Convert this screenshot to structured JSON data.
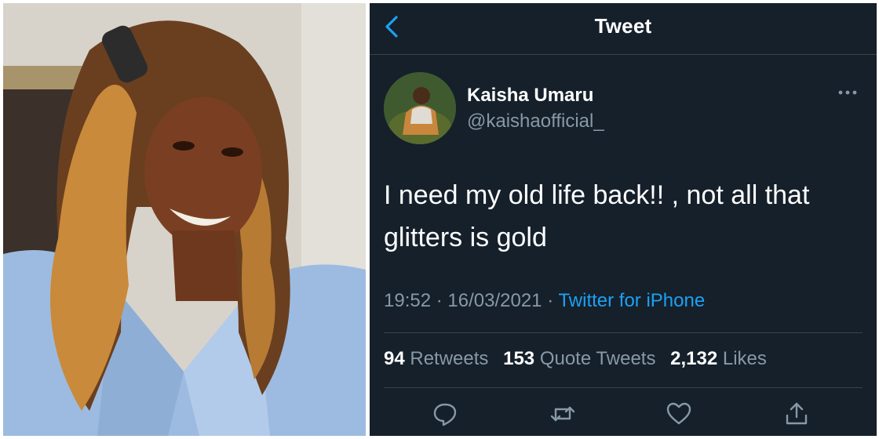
{
  "header": {
    "title": "Tweet",
    "back_icon": "chevron-left-icon"
  },
  "tweet": {
    "display_name": "Kaisha Umaru",
    "handle": "@kaishaofficial_",
    "text_line1": "I need my old life back!! , not all that",
    "text_line2": "glitters is gold",
    "time": "19:52",
    "date": "16/03/2021",
    "source": "Twitter for iPhone",
    "separator": "·"
  },
  "stats": {
    "retweets_count": "94",
    "retweets_label": "Retweets",
    "quotes_count": "153",
    "quotes_label": "Quote Tweets",
    "likes_count": "2,132",
    "likes_label": "Likes"
  },
  "actions": [
    "reply-icon",
    "retweet-icon",
    "like-icon",
    "share-icon"
  ],
  "colors": {
    "background": "#15202b",
    "accent": "#1da1f2",
    "secondary_text": "#8899a6",
    "divider": "#38444d"
  }
}
